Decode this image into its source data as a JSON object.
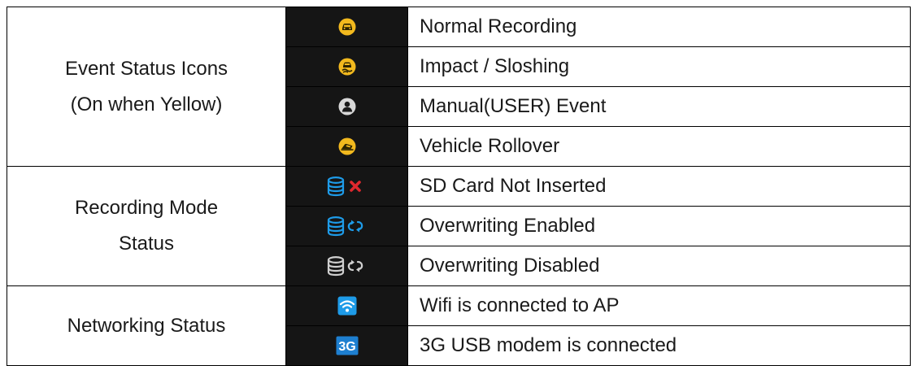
{
  "sections": [
    {
      "category_lines": [
        "Event Status Icons",
        "(On when Yellow)"
      ],
      "rows": [
        {
          "icon": "car-event-icon",
          "label": "Normal Recording"
        },
        {
          "icon": "impact-event-icon",
          "label": "Impact / Sloshing"
        },
        {
          "icon": "user-event-icon",
          "label": "Manual(USER) Event"
        },
        {
          "icon": "rollover-event-icon",
          "label": "Vehicle Rollover"
        }
      ]
    },
    {
      "category_lines": [
        "Recording Mode",
        "Status"
      ],
      "rows": [
        {
          "icon": "sd-card-not-inserted-icon",
          "label": "SD Card Not Inserted"
        },
        {
          "icon": "overwrite-enabled-icon",
          "label": "Overwriting Enabled"
        },
        {
          "icon": "overwrite-disabled-icon",
          "label": "Overwriting Disabled"
        }
      ]
    },
    {
      "category_lines": [
        "Networking Status"
      ],
      "rows": [
        {
          "icon": "wifi-icon",
          "label": "Wifi is connected to AP"
        },
        {
          "icon": "3g-modem-icon",
          "label": "3G USB modem is connected",
          "icon_text": "3G"
        }
      ]
    }
  ],
  "colors": {
    "event_yellow": "#f2b91e",
    "user_gray": "#d8d8d8",
    "storage_blue": "#1e9be8",
    "storage_gray": "#cfcfcf",
    "error_red": "#e0282e",
    "icon_background": "#151515"
  }
}
